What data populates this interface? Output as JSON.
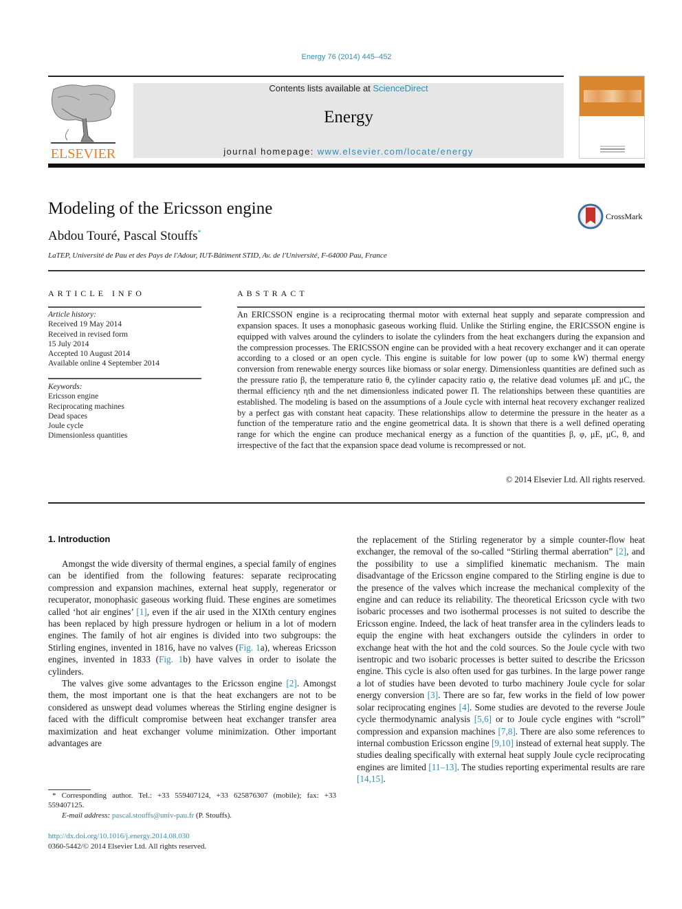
{
  "header": {
    "journal_ref": "Energy 76 (2014) 445–452",
    "contents_prefix": "Contents lists available at ",
    "contents_link": "ScienceDirect",
    "journal_name": "Energy",
    "homepage_prefix": "journal homepage: ",
    "homepage_link": "www.elsevier.com/locate/energy",
    "publisher_logo_text": "ELSEVIER",
    "cover_alt": "Energy journal cover",
    "brand_color": "#f07c1a",
    "link_color": "#2a8fbd"
  },
  "article": {
    "title": "Modeling of the Ericsson engine",
    "authors": "Abdou Touré, Pascal Stouffs",
    "corresponding_mark": "*",
    "affiliation": "LaTEP, Université de Pau et des Pays de l'Adour, IUT-Bâtiment STID, Av. de l'Université, F-64000 Pau, France",
    "crossmark_label": "CrossMark"
  },
  "article_info": {
    "heading": "ARTICLE INFO",
    "history_label": "Article history:",
    "history": [
      "Received 19 May 2014",
      "Received in revised form",
      "15 July 2014",
      "Accepted 10 August 2014",
      "Available online 4 September 2014"
    ],
    "keywords_label": "Keywords:",
    "keywords": [
      "Ericsson engine",
      "Reciprocating machines",
      "Dead spaces",
      "Joule cycle",
      "Dimensionless quantities"
    ]
  },
  "abstract": {
    "heading": "ABSTRACT",
    "text": "An ERICSSON engine is a reciprocating thermal motor with external heat supply and separate compression and expansion spaces. It uses a monophasic gaseous working fluid. Unlike the Stirling engine, the ERICSSON engine is equipped with valves around the cylinders to isolate the cylinders from the heat exchangers during the expansion and the compression processes. The ERICSSON engine can be provided with a heat recovery exchanger and it can operate according to a closed or an open cycle. This engine is suitable for low power (up to some kW) thermal energy conversion from renewable energy sources like biomass or solar energy. Dimensionless quantities are defined such as the pressure ratio β, the temperature ratio θ, the cylinder capacity ratio φ, the relative dead volumes μE and μC, the thermal efficiency ηth and the net dimensionless indicated power Π. The relationships between these quantities are established. The modeling is based on the assumptions of a Joule cycle with internal heat recovery exchanger realized by a perfect gas with constant heat capacity. These relationships allow to determine the pressure in the heater as a function of the temperature ratio and the engine geometrical data. It is shown that there is a well defined operating range for which the engine can produce mechanical energy as a function of the quantities β, φ, μE, μC, θ, and irrespective of the fact that the expansion space dead volume is recompressed or not.",
    "copyright": "© 2014 Elsevier Ltd. All rights reserved."
  },
  "body": {
    "section_heading": "1.  Introduction",
    "left_paragraphs": [
      [
        {
          "t": "Amongst the wide diversity of thermal engines, a special family of engines can be identified from the following features: separate reciprocating compression and expansion machines, external heat supply, regenerator or recuperator, monophasic gaseous working fluid. These engines are sometimes called ‘hot air engines’ "
        },
        {
          "link": "[1]"
        },
        {
          "t": ", even if the air used in the XIXth century engines has been replaced by high pressure hydrogen or helium in a lot of modern engines. The family of hot air engines is divided into two subgroups: the Stirling engines, invented in 1816, have no valves ("
        },
        {
          "link": "Fig. 1"
        },
        {
          "t": "a), whereas Ericsson engines, invented in 1833 ("
        },
        {
          "link": "Fig. 1"
        },
        {
          "t": "b) have valves in order to isolate the cylinders."
        }
      ],
      [
        {
          "t": "The valves give some advantages to the Ericsson engine "
        },
        {
          "link": "[2]"
        },
        {
          "t": ". Amongst them, the most important one is that the heat exchangers are not to be considered as unswept dead volumes whereas the Stirling engine designer is faced with the difficult compromise between heat exchanger transfer area maximization and heat exchanger volume minimization. Other important advantages are"
        }
      ]
    ],
    "right_paragraphs": [
      [
        {
          "t": "the replacement of the Stirling regenerator by a simple counter-flow heat exchanger, the removal of the so-called “Stirling thermal aberration” "
        },
        {
          "link": "[2]"
        },
        {
          "t": ", and the possibility to use a simplified kinematic mechanism. The main disadvantage of the Ericsson engine compared to the Stirling engine is due to the presence of the valves which increase the mechanical complexity of the engine and can reduce its reliability. The theoretical Ericsson cycle with two isobaric processes and two isothermal processes is not suited to describe the Ericsson engine. Indeed, the lack of heat transfer area in the cylinders leads to equip the engine with heat exchangers outside the cylinders in order to exchange heat with the hot and the cold sources. So the Joule cycle with two isentropic and two isobaric processes is better suited to describe the Ericsson engine. This cycle is also often used for gas turbines. In the large power range a lot of studies have been devoted to turbo machinery Joule cycle for solar energy conversion "
        },
        {
          "link": "[3]"
        },
        {
          "t": ". There are so far, few works in the field of low power solar reciprocating engines "
        },
        {
          "link": "[4]"
        },
        {
          "t": ". Some studies are devoted to the reverse Joule cycle thermodynamic analysis "
        },
        {
          "link": "[5,6]"
        },
        {
          "t": " or to Joule cycle engines with “scroll” compression and expansion machines "
        },
        {
          "link": "[7,8]"
        },
        {
          "t": ". There are also some references to internal combustion Ericsson engine "
        },
        {
          "link": "[9,10]"
        },
        {
          "t": " instead of external heat supply. The studies dealing specifically with external heat supply Joule cycle reciprocating engines are limited "
        },
        {
          "link": "[11–13]"
        },
        {
          "t": ". The studies reporting experimental results are rare "
        },
        {
          "link": "[14,15]"
        },
        {
          "t": "."
        }
      ]
    ]
  },
  "footnote": {
    "corresponding": "* Corresponding author. Tel.: +33 559407124, +33 625876307 (mobile); fax: +33 559407125.",
    "email_label": "E-mail address: ",
    "email": "pascal.stouffs@univ-pau.fr",
    "email_suffix": " (P. Stouffs).",
    "doi": "http://dx.doi.org/10.1016/j.energy.2014.08.030",
    "issn": "0360-5442/© 2014 Elsevier Ltd. All rights reserved."
  }
}
